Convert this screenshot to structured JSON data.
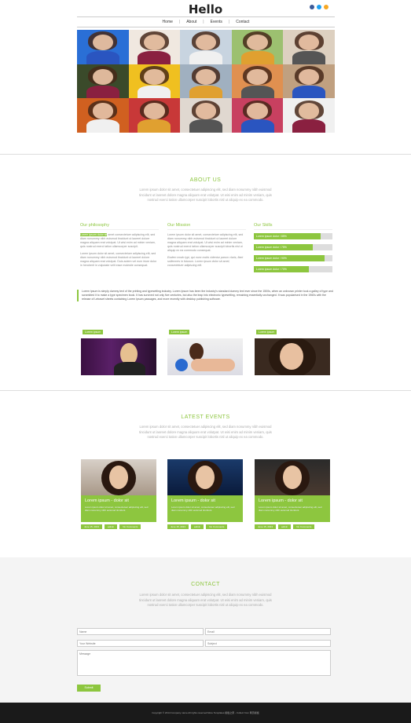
{
  "header": {
    "logo": "Hello",
    "nav": [
      "Home",
      "About",
      "Events",
      "Contact"
    ],
    "social": [
      "#3b5998",
      "#1da1f2",
      "#f7a823"
    ]
  },
  "gallery": [
    [
      "#2a6fd6",
      "#f0e8e0",
      "#c8d4e0",
      "#9cc070",
      "#ddd0c0"
    ],
    [
      "#3a4a2a",
      "#f0c020",
      "#a0b0c0",
      "#e09050",
      "#c0a080"
    ],
    [
      "#d06020",
      "#c83838",
      "#e0d8d0",
      "#c84060",
      "#f0f0f0"
    ]
  ],
  "about": {
    "title": "ABOUT US",
    "intro": "Lorem ipsum dolor sit amet, consectetuer adipiscing elit, sed diam nonummy nibh euismod tincidunt ut laoreet dolore magna aliquam erat volutpat. Ut wisi enim ad minim veniam, quis nostrud exerci tation ullamcorper suscipit lobortis nisl ut aliquip ex ea commodo.",
    "philosophy": {
      "title": "Our philosophy",
      "p1_hl": "Lorem ipsum dolor sit",
      "p1": " amet consectetuer adipiscing elit, sed diam nonummy nibh euismod tincidunt ut laoreet dolore magna aliquam erat volutpat. Ut wisi enim ad minim veniam, quis nostrud exerci tation ullamcorper suscipit.",
      "p2": "Lorem ipsum dolor sit amet, consectetuer adipiscing elit, sed diam nonummy nibh euismod tincidunt ut laoreet dolore magna aliquam erat volutpat. Duis autem vel eum iriure dolor in hendrerit in vulputate velit esse molestie consequat."
    },
    "mission": {
      "title": "Our Mission",
      "p1": "Lorem ipsum dolor sit amet, consectetuer adipiscing elit, sed diam nonummy nibh euismod tincidunt ut laoreet dolore magna aliquam erat volutpat. Ut wisi enim ad minim veniam, quis nostrud exerci tation ullamcorper suscipit lobortis nisl ut aliquip ex ea commodo consequat.",
      "quote": "Eodem modo typi, qui nunc nobis videntur parum claris, fiant sollemnes in futurum. Lorem ipsum dolor sit amet, consectetuer adipiscing elit."
    },
    "skills": {
      "title": "Our Skills",
      "bars": [
        {
          "label": "Lorem ipsum dolor / 85%",
          "value": 0.85
        },
        {
          "label": "Lorem ipsum dolor / 75%",
          "value": 0.75
        },
        {
          "label": "Lorem ipsum dolor / 90%",
          "value": 0.9
        },
        {
          "label": "Lorem ipsum dolor / 70%",
          "value": 0.7
        }
      ]
    },
    "quote": "Lorem Ipsum is simply dummy text of the printing and typesetting industry. Lorem Ipsum has been the industry's standard dummy text ever since the 1500s, when an unknown printer took a galley of type and scrambled it to make a type specimen book. It has survived not only five centuries, but also the leap into electronic typesetting, remaining essentially unchanged. It was popularised in the 1960s with the release of Letraset sheets containing Lorem Ipsum passages, and more recently with desktop publishing software.",
    "team": [
      {
        "tag": "Lorem ipsum"
      },
      {
        "tag": "Lorem ipsum"
      },
      {
        "tag": "Lorem ipsum"
      }
    ]
  },
  "events": {
    "title": "LATEST   EVENTS",
    "intro": "Lorem ipsum dolor sit amet, consectetuer adipiscing elit, sed diam nonummy nibh euismod tincidunt ut laoreet dolore magna aliquam erat volutpat. Ut wisi enim ad minim veniam, quis nostrud exerci tation ullamcorper suscipit lobortis nisl ut aliquip ex ea commodo.",
    "items": [
      {
        "title": "Lorem ipsum - dolor sit",
        "desc": "Lorem ipsum dolor sit amet, consectetuer adipiscing elit, sed diam nonummy nibh euismod tincidunt.",
        "date": "June 15, 2013",
        "author": "admin",
        "comments": "No Comments"
      },
      {
        "title": "Lorem ipsum - dolor sit",
        "desc": "Lorem ipsum dolor sit amet, consectetuer adipiscing elit, sed diam nonummy nibh euismod tincidunt.",
        "date": "June 15, 2013",
        "author": "admin",
        "comments": "No Comments"
      },
      {
        "title": "Lorem ipsum - dolor sit",
        "desc": "Lorem ipsum dolor sit amet, consectetuer adipiscing elit, sed diam nonummy nibh euismod tincidunt.",
        "date": "June 15, 2013",
        "author": "admin",
        "comments": "No Comments"
      }
    ]
  },
  "contact": {
    "title": "CONTACT",
    "intro": "Lorem ipsum dolor sit amet, consectetuer adipiscing elit, sed diam nonummy nibh euismod tincidunt ut laoreet dolore magna aliquam erat volutpat. Ut wisi enim ad minim veniam, quis nostrud exerci tation ullamcorper suscipit lobortis nisl ut aliquip ex ea commodo.",
    "name": "Name",
    "email": "Email",
    "website": "Your Website",
    "subject": "Subject",
    "message": "Message",
    "submit": "Submit"
  },
  "footer": "Copyright © 2014 Company name All rights reserved.More Templates 模板之家 - Collect from 网页模板"
}
